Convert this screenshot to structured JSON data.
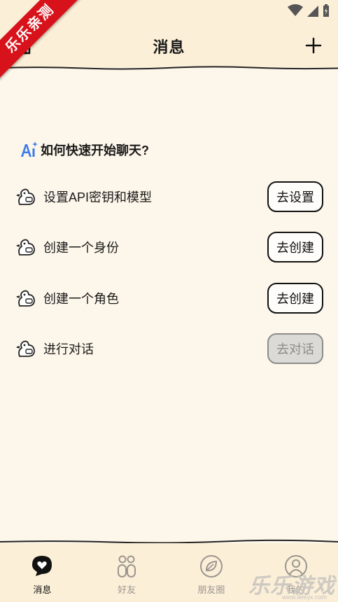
{
  "watermark_ribbon": "乐乐亲测",
  "header": {
    "title": "消息"
  },
  "guide": {
    "title": "如何快速开始聊天?",
    "steps": [
      {
        "label": "设置API密钥和模型",
        "button": "去设置",
        "enabled": true
      },
      {
        "label": "创建一个身份",
        "button": "去创建",
        "enabled": true
      },
      {
        "label": "创建一个角色",
        "button": "去创建",
        "enabled": true
      },
      {
        "label": "进行对话",
        "button": "去对话",
        "enabled": false
      }
    ]
  },
  "tabs": [
    {
      "label": "消息",
      "icon": "chat-heart-icon",
      "active": true
    },
    {
      "label": "好友",
      "icon": "friends-icon",
      "active": false
    },
    {
      "label": "朋友圈",
      "icon": "moments-icon",
      "active": false
    },
    {
      "label": "我的",
      "icon": "profile-icon",
      "active": false
    }
  ],
  "watermark": {
    "brand": "乐乐游戏",
    "url": "www.leleyx.com"
  }
}
